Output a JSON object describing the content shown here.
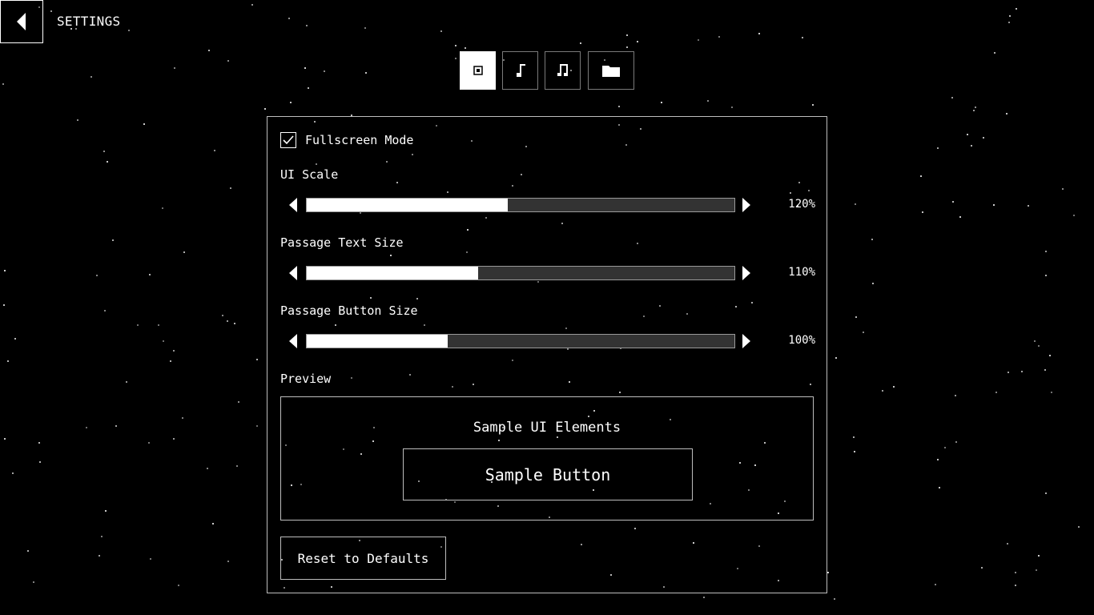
{
  "header": {
    "title": "SETTINGS",
    "back_icon": "back-arrow-icon"
  },
  "tabs": [
    {
      "icon": "display-icon",
      "active": true
    },
    {
      "icon": "music-note-icon",
      "active": false
    },
    {
      "icon": "music-notes-icon",
      "active": false
    },
    {
      "icon": "folder-icon",
      "active": false
    }
  ],
  "settings": {
    "fullscreen": {
      "label": "Fullscreen Mode",
      "checked": true
    },
    "sliders": [
      {
        "label": "UI Scale",
        "value_text": "120%",
        "fill_fraction": 0.47
      },
      {
        "label": "Passage Text Size",
        "value_text": "110%",
        "fill_fraction": 0.4
      },
      {
        "label": "Passage Button Size",
        "value_text": "100%",
        "fill_fraction": 0.33
      }
    ]
  },
  "preview": {
    "label": "Preview",
    "title": "Sample UI Elements",
    "button_label": "Sample Button"
  },
  "reset_label": "Reset to Defaults",
  "colors": {
    "background": "#000000",
    "foreground": "#ffffff",
    "track": "#333333",
    "border": "#bdbdbd"
  }
}
